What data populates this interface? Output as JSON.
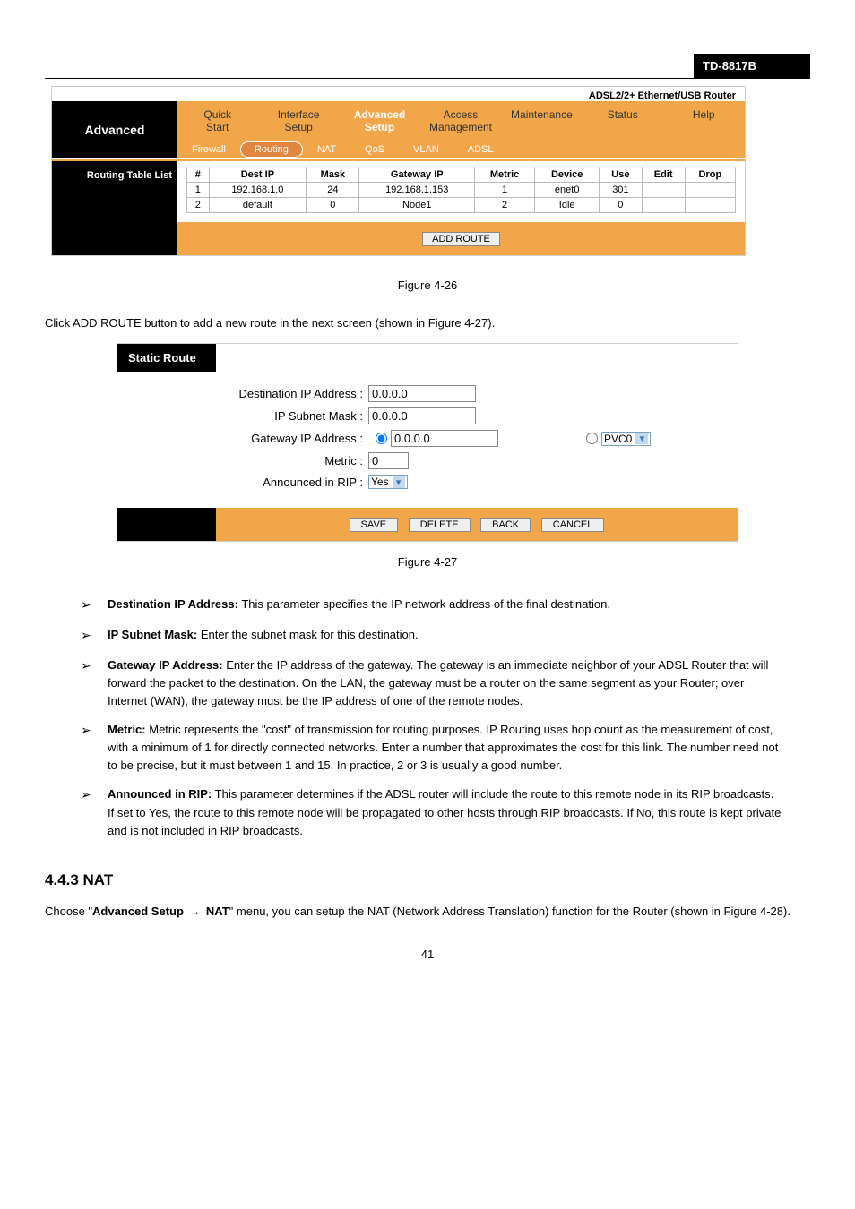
{
  "header": {
    "model": "TD-8817B"
  },
  "router1": {
    "corner_text": "ADSL2/2+ Ethernet/USB Router",
    "sidebar_title": "Advanced",
    "topnav": [
      "Quick\nStart",
      "Interface\nSetup",
      "Advanced\nSetup",
      "Access\nManagement",
      "Maintenance",
      "Status",
      "Help"
    ],
    "subnav": [
      "Firewall",
      "Routing",
      "NAT",
      "QoS",
      "VLAN",
      "ADSL"
    ],
    "section_label": "Routing Table List",
    "table": {
      "headers": [
        "#",
        "Dest IP",
        "Mask",
        "Gateway IP",
        "Metric",
        "Device",
        "Use",
        "Edit",
        "Drop"
      ],
      "rows": [
        [
          "1",
          "192.168.1.0",
          "24",
          "192.168.1.153",
          "1",
          "enet0",
          "301",
          "",
          ""
        ],
        [
          "2",
          "default",
          "0",
          "Node1",
          "2",
          "Idle",
          "0",
          "",
          ""
        ]
      ]
    },
    "add_route_btn": "ADD ROUTE"
  },
  "caption1": "Figure 4-26",
  "caption1_desc": "Click ADD ROUTE button to add a new route in the next screen (shown in Figure 4-27).",
  "form": {
    "title": "Static Route",
    "labels": {
      "dest": "Destination IP Address :",
      "mask": "IP Subnet Mask :",
      "gw": "Gateway IP Address :",
      "metric": "Metric :",
      "rip": "Announced in RIP :"
    },
    "values": {
      "dest": "0.0.0.0",
      "mask": "0.0.0.0",
      "gw": "0.0.0.0",
      "metric": "0",
      "rip": "Yes",
      "pvc": "PVC0"
    },
    "buttons": {
      "save": "SAVE",
      "delete": "DELETE",
      "back": "BACK",
      "cancel": "CANCEL"
    }
  },
  "caption2": "Figure 4-27",
  "bullets": [
    {
      "term": "Destination IP Address:",
      "text": "This parameter specifies the IP network address of the final destination."
    },
    {
      "term": "IP Subnet Mask:",
      "text": "Enter the subnet mask for this destination."
    },
    {
      "term": "Gateway IP Address:",
      "text": "Enter the IP address of the gateway. The gateway is an immediate neighbor of your ADSL Router that will forward the packet to the destination. On the LAN, the gateway must be a router on the same segment as your Router; over Internet (WAN), the gateway must be the IP address of one of the remote nodes."
    },
    {
      "term": "Metric:",
      "text": "Metric represents the \"cost\" of transmission for routing purposes. IP Routing uses hop count as the measurement of cost, with a minimum of 1 for directly connected networks. Enter a number that approximates the cost for this link. The number need not to be precise, but it must between 1 and 15. In practice, 2 or 3 is usually a good number."
    },
    {
      "term": "Announced in RIP:",
      "text": "This parameter determines if the ADSL router will include the route to this remote node in its RIP broadcasts. If set to Yes, the route to this remote node will be propagated to other hosts through RIP broadcasts. If No, this route is kept private and is not included in RIP broadcasts."
    }
  ],
  "nat": {
    "heading": "4.4.3 NAT",
    "para1_part1": "Choose \"",
    "menu1": "Advanced Setup",
    "menu2": "NAT",
    "para1_part2": "\" menu, you can setup the NAT (Network Address Translation) function for the Router (shown in Figure 4-28).",
    "page_num": "41"
  }
}
